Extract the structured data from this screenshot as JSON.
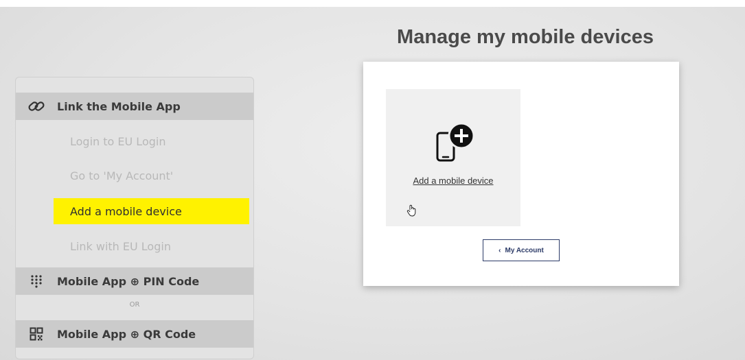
{
  "page": {
    "title": "Manage my mobile devices"
  },
  "steps_panel": {
    "sections": [
      {
        "label": "Link the Mobile App",
        "icon": "link-icon"
      },
      {
        "label": "Mobile App ⊕ PIN Code",
        "icon": "keypad-icon"
      },
      {
        "label": "Mobile App ⊕ QR Code",
        "icon": "qr-code-icon"
      }
    ],
    "substeps": [
      {
        "label": "Login to EU Login",
        "active": false
      },
      {
        "label": "Go to 'My Account'",
        "active": false
      },
      {
        "label": "Add a mobile device",
        "active": true
      },
      {
        "label": "Link with EU Login",
        "active": false
      }
    ],
    "or_label": "OR",
    "highlight_color": "#fff200"
  },
  "card": {
    "tile": {
      "icon": "mobile-add-icon",
      "link_label": "Add a mobile device"
    },
    "back_button": {
      "chevron": "‹",
      "label": "My Account"
    }
  }
}
